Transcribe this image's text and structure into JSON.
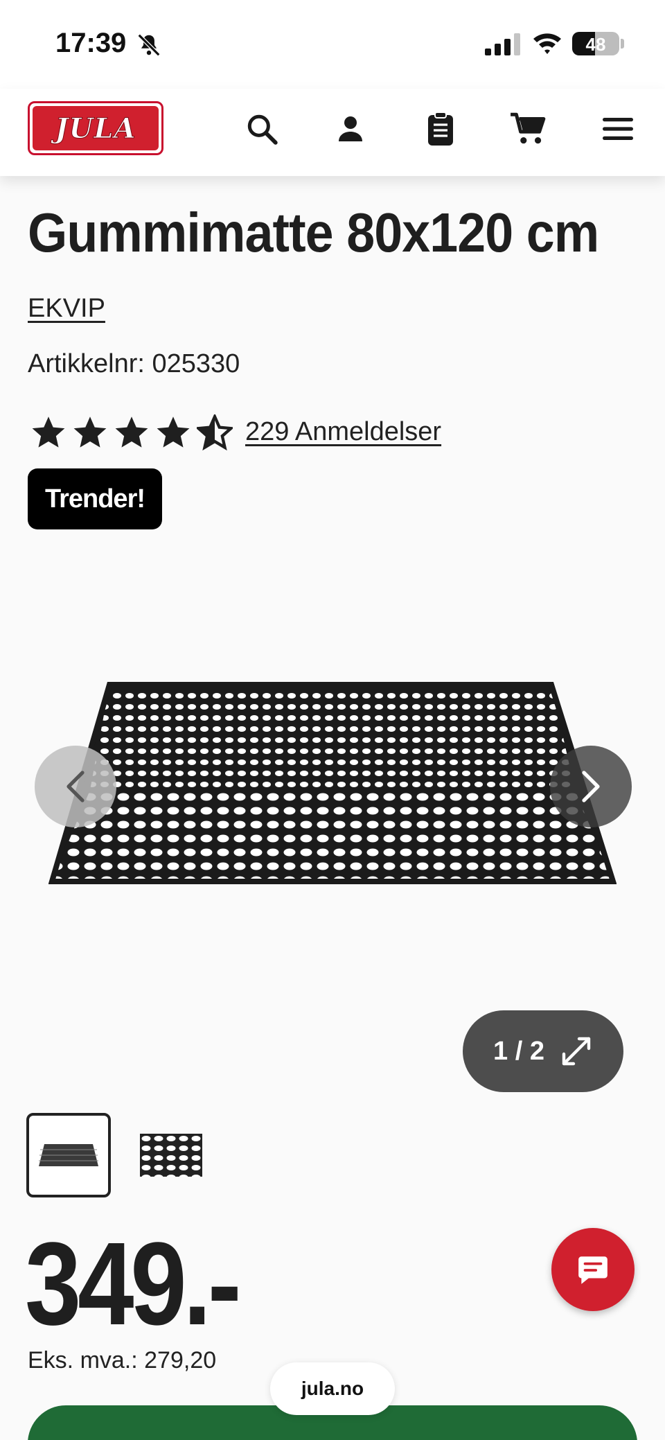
{
  "status_bar": {
    "time": "17:39",
    "battery": "48",
    "battery_level": 0.48,
    "icons": [
      "bell-slash-icon",
      "signal-icon",
      "wifi-icon",
      "battery-icon"
    ]
  },
  "header": {
    "logo_text": "JULA",
    "icons": [
      "search-icon",
      "account-icon",
      "shopping-list-icon",
      "cart-icon",
      "menu-icon"
    ]
  },
  "product": {
    "title": "Gummimatte 80x120 cm",
    "brand": "EKVIP",
    "article_number": "Artikkelnr: 025330",
    "rating": 4.5,
    "rating_max": 5,
    "reviews": "229 Anmeldelser",
    "badge": "Trender!"
  },
  "gallery": {
    "counter": "1 / 2",
    "current": 1,
    "total": 2
  },
  "price": {
    "value": "349.-",
    "ex_vat": "Eks. mva.: 279,20"
  },
  "browser": {
    "url": "jula.no"
  },
  "colors": {
    "brand_red": "#d0202e",
    "buy_green": "#1f6b36",
    "badge_black": "#000000"
  }
}
